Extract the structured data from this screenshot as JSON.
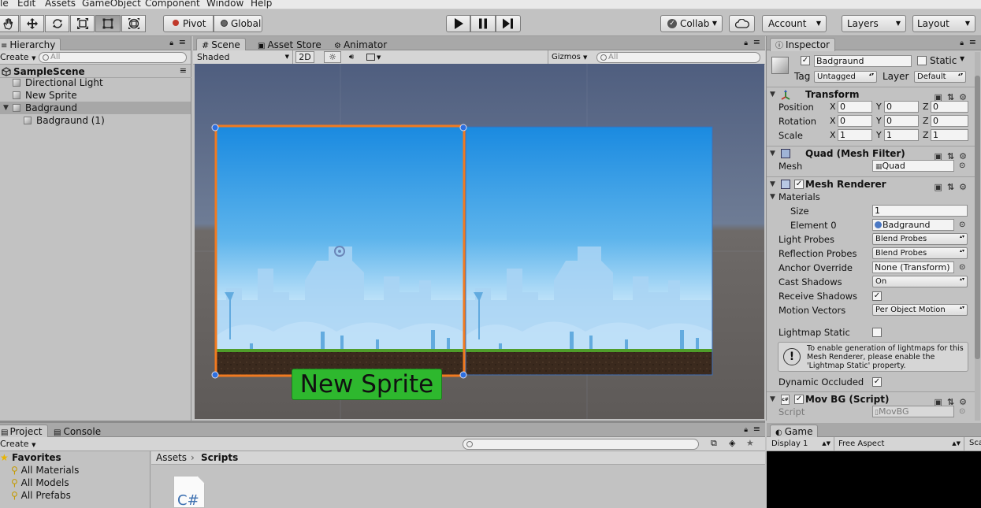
{
  "menu": [
    "le",
    "Edit",
    "Assets",
    "GameObject",
    "Component",
    "Window",
    "Help"
  ],
  "toolbar": {
    "tools": [
      "hand-tool",
      "move-tool",
      "rotate-tool",
      "scale-tool",
      "rect-tool",
      "transform-tool"
    ],
    "pivot": "Pivot",
    "global": "Global",
    "collab": "Collab",
    "account": "Account",
    "layers": "Layers",
    "layout": "Layout"
  },
  "hierarchy": {
    "tab": "Hierarchy",
    "create": "Create",
    "search_placeholder": "All",
    "scene": "SampleScene",
    "items": [
      {
        "label": "Directional Light"
      },
      {
        "label": "New Sprite"
      },
      {
        "label": "Badgraund"
      },
      {
        "label": "Badgraund (1)"
      }
    ]
  },
  "scene": {
    "tabs": [
      "Scene",
      "Asset Store",
      "Animator"
    ],
    "shading": "Shaded",
    "mode2d": "2D",
    "gizmos": "Gizmos",
    "search_placeholder": "All",
    "sprite_label": "New Sprite"
  },
  "inspector": {
    "tab": "Inspector",
    "object_name": "Badgraund",
    "static_label": "Static",
    "tag_label": "Tag",
    "tag_value": "Untagged",
    "layer_label": "Layer",
    "layer_value": "Default",
    "transform": {
      "title": "Transform",
      "position_label": "Position",
      "position": [
        "0",
        "0",
        "0"
      ],
      "rotation_label": "Rotation",
      "rotation": [
        "0",
        "0",
        "0"
      ],
      "scale_label": "Scale",
      "scale": [
        "1",
        "1",
        "1"
      ]
    },
    "mesh_filter": {
      "title": "Quad (Mesh Filter)",
      "mesh_label": "Mesh",
      "mesh_value": "Quad"
    },
    "mesh_renderer": {
      "title": "Mesh Renderer",
      "materials_label": "Materials",
      "size_label": "Size",
      "size_value": "1",
      "element0_label": "Element 0",
      "element0_value": "Badgraund",
      "light_probes_label": "Light Probes",
      "light_probes_value": "Blend Probes",
      "reflection_probes_label": "Reflection Probes",
      "reflection_probes_value": "Blend Probes",
      "anchor_override_label": "Anchor Override",
      "anchor_override_value": "None (Transform)",
      "cast_shadows_label": "Cast Shadows",
      "cast_shadows_value": "On",
      "receive_shadows_label": "Receive Shadows",
      "motion_vectors_label": "Motion Vectors",
      "motion_vectors_value": "Per Object Motion",
      "lightmap_static_label": "Lightmap Static",
      "info_text": "To enable generation of lightmaps for this Mesh Renderer, please enable the 'Lightmap Static' property.",
      "dynamic_occluded_label": "Dynamic Occluded"
    },
    "script_comp": {
      "title": "Mov BG (Script)",
      "script_label": "Script",
      "script_value": "MovBG"
    }
  },
  "project": {
    "tabs": [
      "Project",
      "Console"
    ],
    "create": "Create",
    "favorites_label": "Favorites",
    "favorites": [
      "All Materials",
      "All Models",
      "All Prefabs"
    ],
    "breadcrumb_root": "Assets",
    "breadcrumb_current": "Scripts",
    "file_icon_text": "C#"
  },
  "game": {
    "tab": "Game",
    "display": "Display 1",
    "aspect": "Free Aspect",
    "scale_label": "Sca"
  },
  "colors": {
    "sky_top": "#1f8fe0",
    "sky_bottom": "#e8f6ff",
    "selection": "#f07a20",
    "sprite_green": "#2eb82e"
  }
}
